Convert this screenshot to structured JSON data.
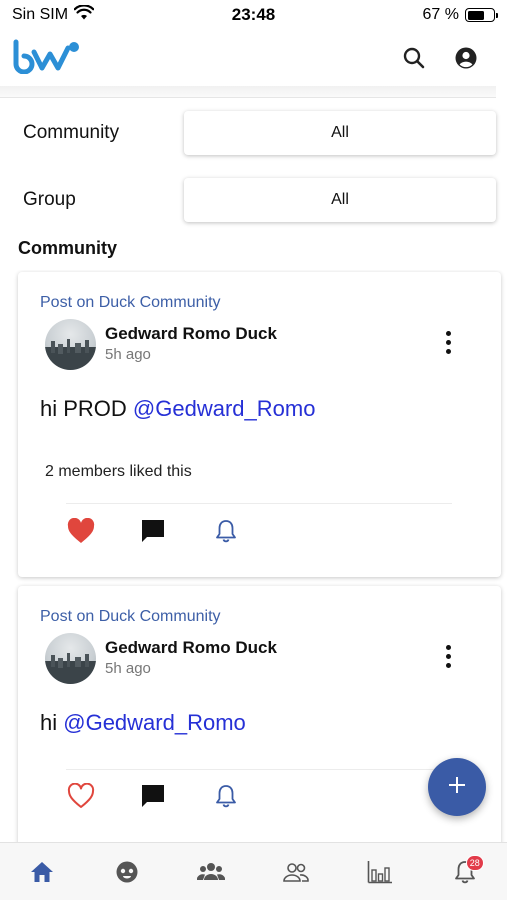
{
  "status_bar": {
    "carrier": "Sin SIM",
    "time": "23:48",
    "battery_percent": "67 %",
    "battery_level": 0.67
  },
  "app_bar": {
    "logo_icon": "bw-logo",
    "search_icon": "search-icon",
    "profile_icon": "account-circle-icon"
  },
  "filters": {
    "community": {
      "label": "Community",
      "value": "All"
    },
    "group": {
      "label": "Group",
      "value": "All"
    }
  },
  "section_title": "Community",
  "posts": [
    {
      "context": "Post on Duck Community",
      "author": "Gedward Romo Duck",
      "time": "5h ago",
      "body_text": "hi PROD ",
      "mention": "@Gedward_Romo",
      "likes_text": "2 members liked this",
      "liked": true
    },
    {
      "context": "Post on Duck Community",
      "author": "Gedward Romo Duck",
      "time": "5h ago",
      "body_text": "hi ",
      "mention": "@Gedward_Romo",
      "liked": false
    }
  ],
  "fab_icon": "plus-icon",
  "bottom_nav": {
    "items": [
      "home-icon",
      "explore-icon",
      "groups-icon",
      "members-icon",
      "stats-icon",
      "notifications-icon"
    ],
    "notification_badge": "28"
  },
  "colors": {
    "primary": "#3a5ba6",
    "mention": "#2630d6",
    "like": "#e0463d",
    "badge": "#e23b4a"
  }
}
